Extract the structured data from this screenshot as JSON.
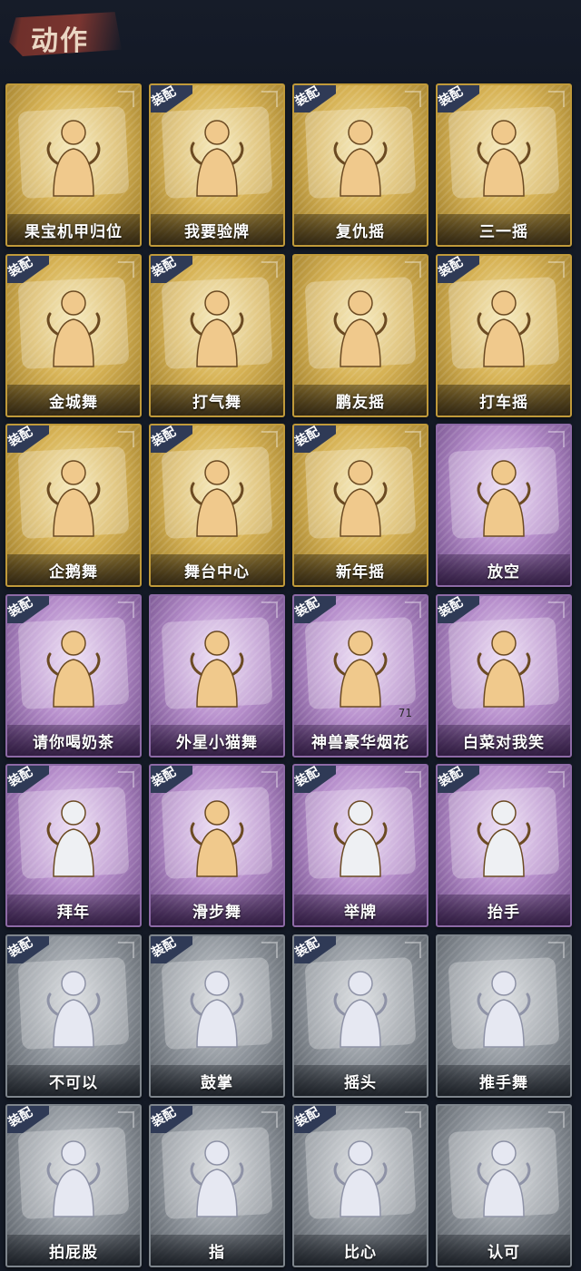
{
  "header": {
    "title": "动作"
  },
  "colors": {
    "gold": "#d7b356",
    "purple": "#b78fcc",
    "gray": "#8f959c",
    "badge": "#2f3a56"
  },
  "badge_label": "装配",
  "cards": [
    {
      "label": "果宝机甲归位",
      "tier": "gold",
      "equipped": false,
      "icon": "dance-pose-icon"
    },
    {
      "label": "我要验牌",
      "tier": "gold",
      "equipped": true,
      "icon": "dance-pose-icon"
    },
    {
      "label": "复仇摇",
      "tier": "gold",
      "equipped": true,
      "icon": "dance-pose-icon"
    },
    {
      "label": "三一摇",
      "tier": "gold",
      "equipped": true,
      "icon": "dance-pose-icon"
    },
    {
      "label": "金城舞",
      "tier": "gold",
      "equipped": true,
      "icon": "dance-pose-icon"
    },
    {
      "label": "打气舞",
      "tier": "gold",
      "equipped": true,
      "icon": "dance-pose-icon"
    },
    {
      "label": "鹏友摇",
      "tier": "gold",
      "equipped": false,
      "icon": "dance-pose-icon"
    },
    {
      "label": "打车摇",
      "tier": "gold",
      "equipped": true,
      "icon": "dance-pose-icon"
    },
    {
      "label": "企鹅舞",
      "tier": "gold",
      "equipped": true,
      "icon": "dance-pose-icon"
    },
    {
      "label": "舞台中心",
      "tier": "gold",
      "equipped": true,
      "icon": "dance-pose-icon"
    },
    {
      "label": "新年摇",
      "tier": "gold",
      "equipped": true,
      "icon": "dance-pose-icon"
    },
    {
      "label": "放空",
      "tier": "purple",
      "equipped": false,
      "icon": "hooded-figure-icon"
    },
    {
      "label": "请你喝奶茶",
      "tier": "purple",
      "equipped": true,
      "icon": "banner-pose-icon"
    },
    {
      "label": "外星小猫舞",
      "tier": "purple",
      "equipped": false,
      "icon": "dance-pose-icon"
    },
    {
      "label": "神兽豪华烟花",
      "tier": "purple",
      "equipped": true,
      "icon": "fireworks-icon",
      "count": "71"
    },
    {
      "label": "白菜对我笑",
      "tier": "purple",
      "equipped": true,
      "icon": "dance-pose-icon"
    },
    {
      "label": "拜年",
      "tier": "purple",
      "equipped": true,
      "icon": "bow-pose-icon"
    },
    {
      "label": "滑步舞",
      "tier": "purple",
      "equipped": true,
      "icon": "dance-pose-icon"
    },
    {
      "label": "举牌",
      "tier": "purple",
      "equipped": true,
      "icon": "sign-holding-icon"
    },
    {
      "label": "抬手",
      "tier": "purple",
      "equipped": true,
      "icon": "raise-hand-icon"
    },
    {
      "label": "不可以",
      "tier": "gray",
      "equipped": true,
      "icon": "finger-wag-icon"
    },
    {
      "label": "鼓掌",
      "tier": "gray",
      "equipped": true,
      "icon": "clap-icon"
    },
    {
      "label": "摇头",
      "tier": "gray",
      "equipped": true,
      "icon": "head-shake-icon"
    },
    {
      "label": "推手舞",
      "tier": "gray",
      "equipped": false,
      "icon": "push-dance-icon"
    },
    {
      "label": "拍屁股",
      "tier": "gray",
      "equipped": true,
      "icon": "butt-slap-icon"
    },
    {
      "label": "指",
      "tier": "gray",
      "equipped": true,
      "icon": "point-icon"
    },
    {
      "label": "比心",
      "tier": "gray",
      "equipped": true,
      "icon": "finger-heart-icon"
    },
    {
      "label": "认可",
      "tier": "gray",
      "equipped": false,
      "icon": "thumbs-up-icon"
    }
  ]
}
